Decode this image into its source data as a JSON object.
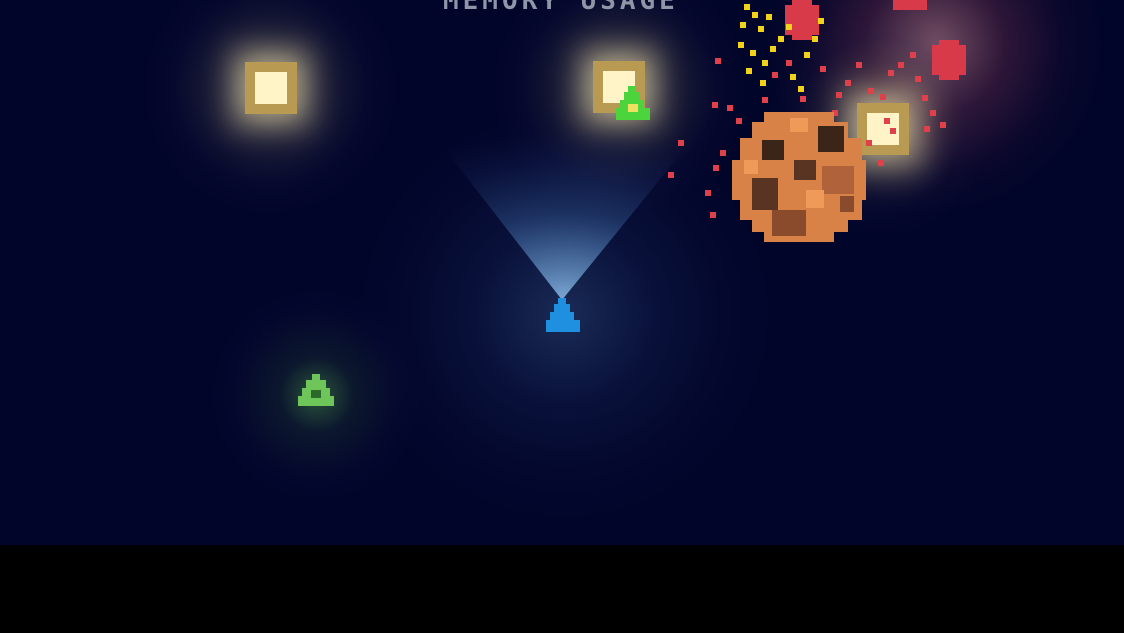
{
  "hud": {
    "title": "MEMORY USAGE"
  },
  "colors": {
    "space": "#02052a",
    "ground": "#000000",
    "player_ship": "#1f8fe0",
    "enemy_ship": "#4cd43c",
    "asteroid": "#d98248",
    "lamp_frame": "#b89a52",
    "lamp_core": "#fff4c8",
    "debris_red": "#e0404a",
    "debris_yellow": "#f3d21c"
  },
  "sprites": {
    "player": "player-ship-icon",
    "enemy": "enemy-ship-icon",
    "asteroid": "asteroid-icon",
    "lamp": "light-beacon-icon"
  }
}
